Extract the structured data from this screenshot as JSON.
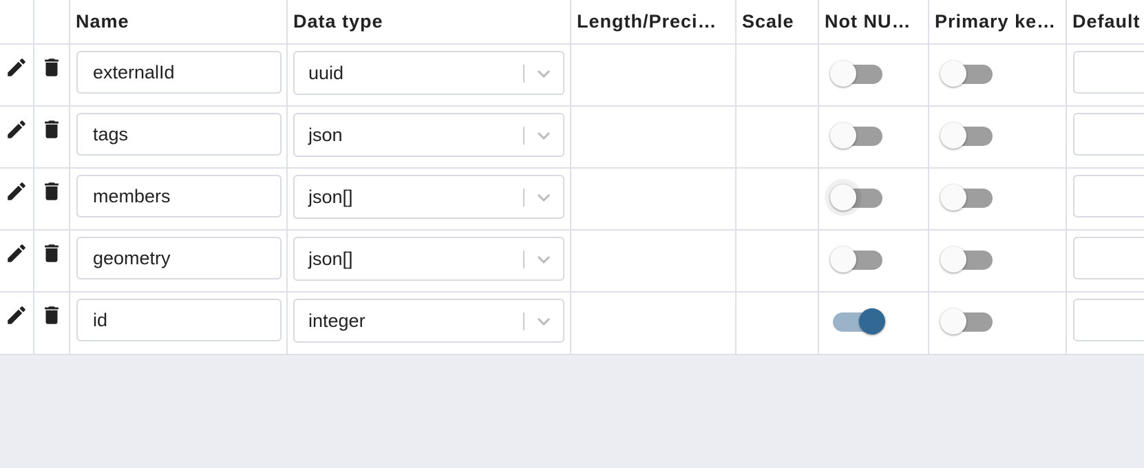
{
  "columns": {
    "edit": "",
    "delete": "",
    "name": "Name",
    "data_type": "Data type",
    "length": "Length/Preci…",
    "scale": "Scale",
    "not_null": "Not NU…",
    "primary_key": "Primary ke…",
    "default": "Default"
  },
  "rows": [
    {
      "name": "externalId",
      "data_type": "uuid",
      "length": "",
      "scale": "",
      "not_null": false,
      "primary_key": false,
      "default": ""
    },
    {
      "name": "tags",
      "data_type": "json",
      "length": "",
      "scale": "",
      "not_null": false,
      "primary_key": false,
      "default": ""
    },
    {
      "name": "members",
      "data_type": "json[]",
      "length": "",
      "scale": "",
      "not_null": false,
      "primary_key": false,
      "default": ""
    },
    {
      "name": "geometry",
      "data_type": "json[]",
      "length": "",
      "scale": "",
      "not_null": false,
      "primary_key": false,
      "default": ""
    },
    {
      "name": "id",
      "data_type": "integer",
      "length": "",
      "scale": "",
      "not_null": true,
      "primary_key": false,
      "default": ""
    }
  ],
  "icons": {
    "edit": "pencil-icon",
    "delete": "trash-icon",
    "dropdown": "chevron-down-icon"
  },
  "colors": {
    "toggle_on_thumb": "#326894",
    "toggle_on_track": "#9ab3c9",
    "toggle_off_track": "#9e9e9e",
    "background": "#ebedf2"
  }
}
